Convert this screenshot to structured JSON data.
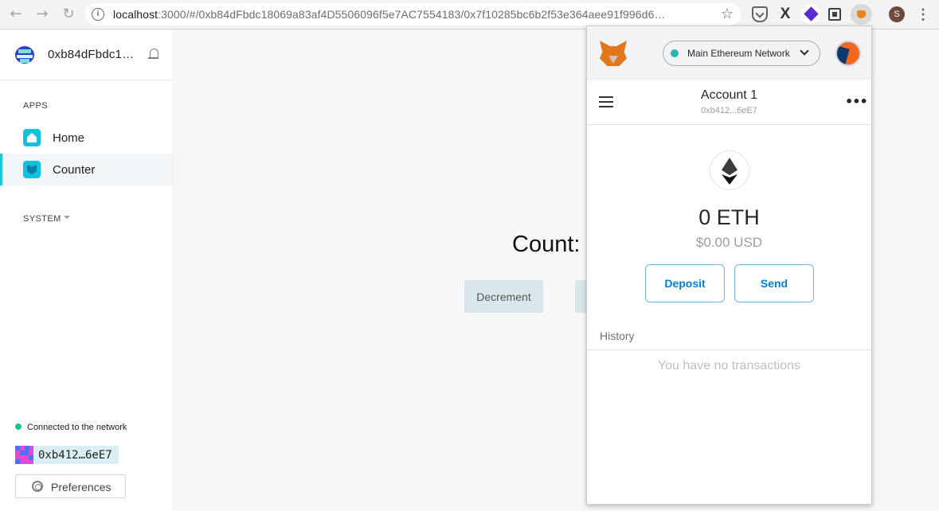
{
  "browser": {
    "url_host": "localhost",
    "url_path": ":3000/#/0xb84dFbdc18069a83af4D5506096f5e7AC7554183/0x7f10285bc6b2f53e364aee91f996d6…",
    "profile_initial": "S"
  },
  "sidebar": {
    "dao_address": "0xb84dFbdc1…",
    "apps_label": "APPS",
    "items": [
      {
        "label": "Home"
      },
      {
        "label": "Counter"
      }
    ],
    "system_label": "SYSTEM",
    "network_status": "Connected to the network",
    "account_short": "0xb412…6eE7",
    "preferences_label": "Preferences"
  },
  "main": {
    "count_label": "Count:",
    "decrement_label": "Decrement"
  },
  "metamask": {
    "network": "Main Ethereum Network",
    "account_name": "Account 1",
    "account_address": "0xb412...6eE7",
    "balance": "0 ETH",
    "balance_usd": "$0.00 USD",
    "deposit_label": "Deposit",
    "send_label": "Send",
    "history_label": "History",
    "empty_history": "You have no transactions"
  },
  "colors": {
    "accent": "#1cc7d4",
    "metamask_blue": "#037dd6",
    "connected": "#16c98d"
  }
}
